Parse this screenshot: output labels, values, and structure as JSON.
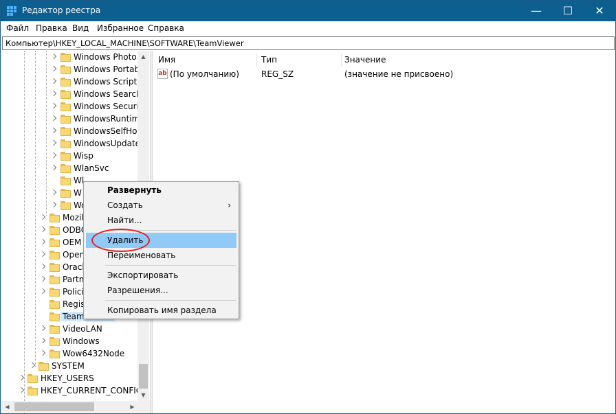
{
  "window": {
    "title": "Редактор реестра",
    "controls": {
      "minimize": "—",
      "maximize": "☐",
      "close": "✕"
    }
  },
  "menu": [
    "Файл",
    "Правка",
    "Вид",
    "Избранное",
    "Справка"
  ],
  "address": "Компьютер\\HKEY_LOCAL_MACHINE\\SOFTWARE\\TeamViewer",
  "tree": {
    "items": [
      {
        "label": "Windows Photo V",
        "level": 4,
        "expandable": true
      },
      {
        "label": "Windows Portabl",
        "level": 4,
        "expandable": true
      },
      {
        "label": "Windows Script H",
        "level": 4,
        "expandable": true
      },
      {
        "label": "Windows Search",
        "level": 4,
        "expandable": true
      },
      {
        "label": "Windows Security",
        "level": 4,
        "expandable": true
      },
      {
        "label": "WindowsRuntime",
        "level": 4,
        "expandable": true
      },
      {
        "label": "WindowsSelfHost",
        "level": 4,
        "expandable": true
      },
      {
        "label": "WindowsUpdate",
        "level": 4,
        "expandable": true
      },
      {
        "label": "Wisp",
        "level": 4,
        "expandable": true
      },
      {
        "label": "WlanSvc",
        "level": 4,
        "expandable": true
      },
      {
        "label": "Wl",
        "level": 4,
        "expandable": false
      },
      {
        "label": "W",
        "level": 4,
        "expandable": true
      },
      {
        "label": "Wo",
        "level": 4,
        "expandable": true
      },
      {
        "label": "Mozil",
        "level": 3,
        "expandable": true
      },
      {
        "label": "ODBC",
        "level": 3,
        "expandable": true
      },
      {
        "label": "OEM",
        "level": 3,
        "expandable": true
      },
      {
        "label": "Open",
        "level": 3,
        "expandable": true
      },
      {
        "label": "Oracl",
        "level": 3,
        "expandable": true
      },
      {
        "label": "Partn",
        "level": 3,
        "expandable": true
      },
      {
        "label": "Polici",
        "level": 3,
        "expandable": true
      },
      {
        "label": "Regis",
        "level": 3,
        "expandable": false
      },
      {
        "label": "TeamViewer",
        "level": 3,
        "expandable": false,
        "selected": true
      },
      {
        "label": "VideoLAN",
        "level": 3,
        "expandable": true
      },
      {
        "label": "Windows",
        "level": 3,
        "expandable": true
      },
      {
        "label": "Wow6432Node",
        "level": 3,
        "expandable": true
      },
      {
        "label": "SYSTEM",
        "level": 2,
        "expandable": true
      },
      {
        "label": "HKEY_USERS",
        "level": 1,
        "expandable": true
      },
      {
        "label": "HKEY_CURRENT_CONFIG",
        "level": 1,
        "expandable": true
      }
    ]
  },
  "list": {
    "columns": [
      "Имя",
      "Тип",
      "Значение"
    ],
    "rows": [
      {
        "icon": "string-value-icon",
        "icon_text": "ab",
        "name": "(По умолчанию)",
        "type": "REG_SZ",
        "value": "(значение не присвоено)"
      }
    ]
  },
  "context_menu": {
    "items": [
      {
        "label": "Развернуть",
        "bold": true
      },
      {
        "label": "Создать",
        "submenu": true,
        "arrow": "›"
      },
      {
        "label": "Найти..."
      },
      {
        "separator": true
      },
      {
        "label": "Удалить",
        "highlighted": true
      },
      {
        "label": "Переименовать"
      },
      {
        "separator": true
      },
      {
        "label": "Экспортировать"
      },
      {
        "label": "Разрешения..."
      },
      {
        "separator": true
      },
      {
        "label": "Копировать имя раздела"
      }
    ]
  },
  "annotation_color": "#e02020",
  "highlight_color": "#91c9f7",
  "titlebar_color": "#0d5f8f"
}
